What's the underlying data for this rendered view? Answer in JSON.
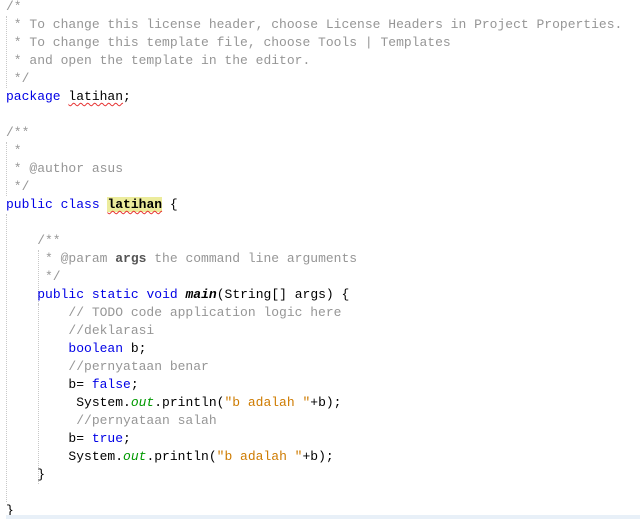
{
  "editor": {
    "language": "java",
    "lines": [
      "/*",
      " * To change this license header, choose License Headers in Project Properties.",
      " * To change this template file, choose Tools | Templates",
      " * and open the template in the editor.",
      " */",
      "package latihan;",
      "",
      "/**",
      " *",
      " * @author asus",
      " */",
      "public class latihan {",
      "",
      "    /**",
      "     * @param args the command line arguments",
      "     */",
      "    public static void main(String[] args) {",
      "        // TODO code application logic here",
      "        //deklarasi",
      "        boolean b;",
      "        //pernyataan benar",
      "        b= false;",
      "         System.out.println(\"b adalah \"+b);",
      "         //pernyataan salah",
      "        b= true;",
      "        System.out.println(\"b adalah \"+b);",
      "    }",
      "",
      "}"
    ],
    "tokens": {
      "package_kw": "package",
      "package_name": "latihan",
      "public": "public",
      "class": "class",
      "class_name": "latihan",
      "static": "static",
      "void": "void",
      "main": "main",
      "main_params": "(String[] args) {",
      "param_tag": "@param",
      "args": "args",
      "param_desc": " the command line arguments",
      "boolean": "boolean",
      "false": "false",
      "true": "true",
      "system": "System.",
      "out": "out",
      "println": ".println(",
      "string": "\"b adalah \"",
      "plus_b": "+b);"
    },
    "highlighted_symbol": "latihan"
  }
}
